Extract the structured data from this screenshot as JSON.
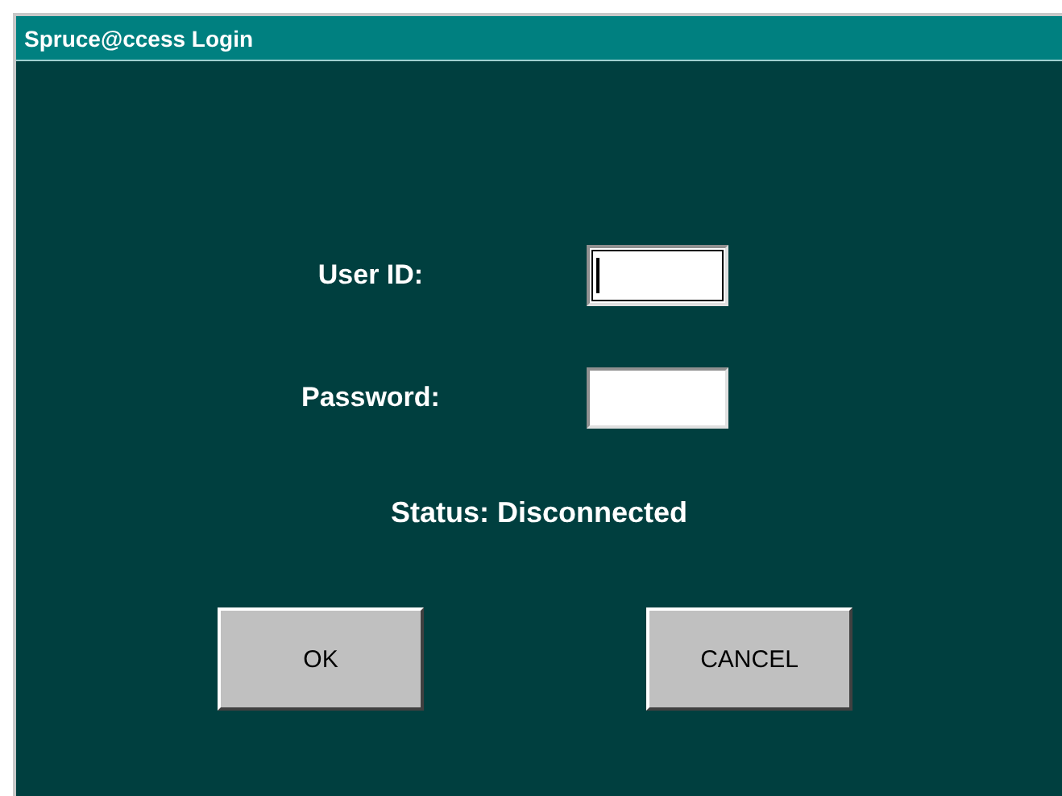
{
  "window": {
    "title": "Spruce@ccess Login"
  },
  "fields": [
    {
      "label": "User ID:",
      "focused": true
    },
    {
      "label": "Password:",
      "focused": false
    }
  ],
  "status": "Status: Disconnected",
  "buttons": [
    "OK",
    "CANCEL"
  ]
}
